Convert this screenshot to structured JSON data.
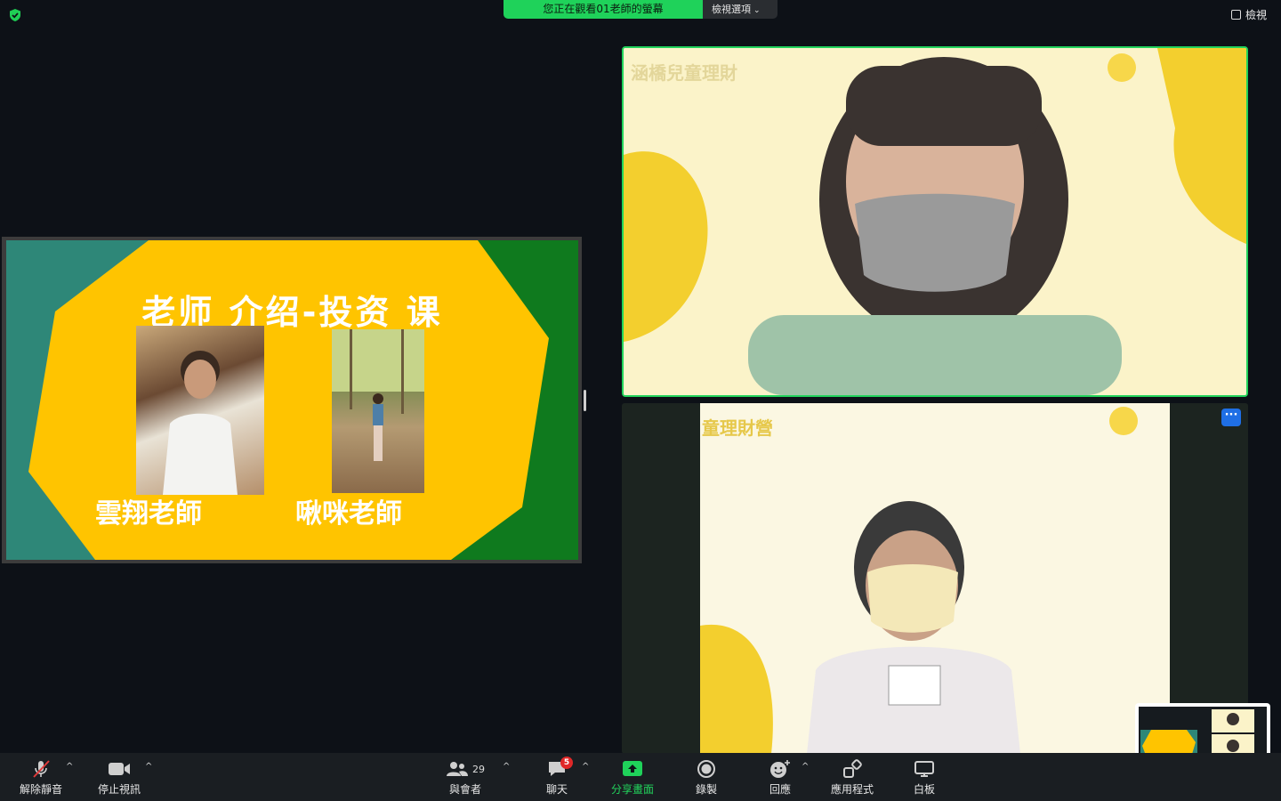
{
  "top": {
    "share_banner": "您正在觀看01老師的螢幕",
    "view_options": "檢視選項",
    "view_button": "檢視"
  },
  "slide": {
    "title": "老师 介绍-投资 课",
    "teachers": [
      "雲翔老師",
      "啾咪老師"
    ]
  },
  "tiles": {
    "tile1_watermark": "涵橋兒童理財",
    "tile2_watermark": "童理財營",
    "more_label": "···"
  },
  "toolbar": {
    "unmute": "解除靜音",
    "stop_video": "停止視訊",
    "participants": "與會者",
    "participants_count": "29",
    "chat": "聊天",
    "chat_badge": "5",
    "share": "分享畫面",
    "record": "錄製",
    "reactions": "回應",
    "apps": "應用程式",
    "whiteboard": "白板"
  },
  "colors": {
    "share_green": "#1fd25a",
    "active_speaker_border": "#22d35c",
    "slide_yellow": "#ffc400",
    "slide_teal": "#2e8778",
    "slide_green": "#0f7a1e"
  }
}
